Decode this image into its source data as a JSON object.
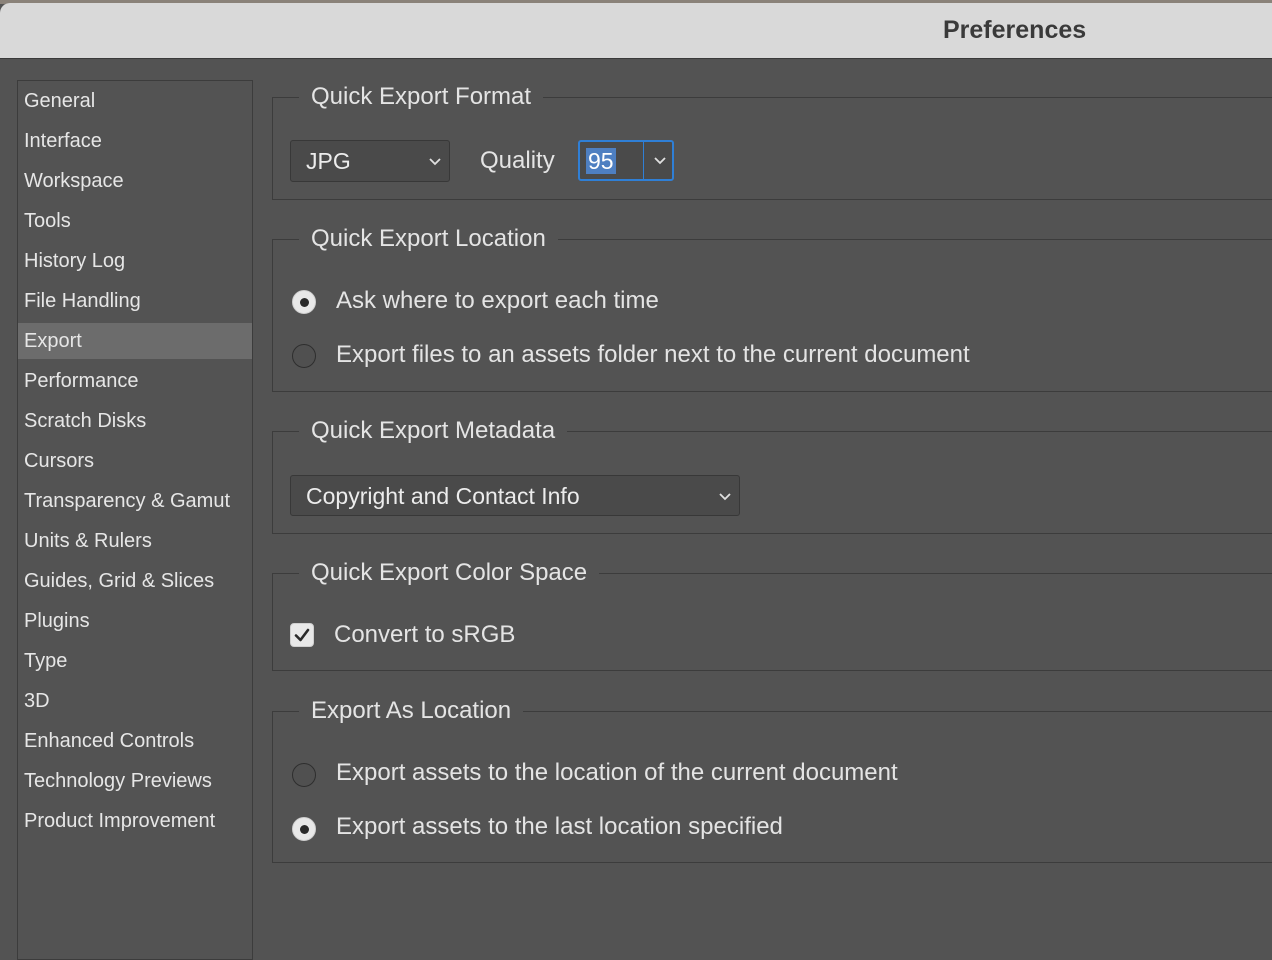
{
  "window": {
    "title": "Preferences"
  },
  "sidebar": {
    "selected": "Export",
    "items": [
      {
        "label": "General"
      },
      {
        "label": "Interface"
      },
      {
        "label": "Workspace"
      },
      {
        "label": "Tools"
      },
      {
        "label": "History Log"
      },
      {
        "label": "File Handling"
      },
      {
        "label": "Export"
      },
      {
        "label": "Performance"
      },
      {
        "label": "Scratch Disks"
      },
      {
        "label": "Cursors"
      },
      {
        "label": "Transparency & Gamut"
      },
      {
        "label": "Units & Rulers"
      },
      {
        "label": "Guides, Grid & Slices"
      },
      {
        "label": "Plugins"
      },
      {
        "label": "Type"
      },
      {
        "label": "3D"
      },
      {
        "label": "Enhanced Controls"
      },
      {
        "label": "Technology Previews"
      },
      {
        "label": "Product Improvement"
      }
    ]
  },
  "quick_export_format": {
    "title": "Quick Export Format",
    "format_value": "JPG",
    "quality_label": "Quality",
    "quality_value": "95"
  },
  "quick_export_location": {
    "title": "Quick Export Location",
    "options": [
      {
        "label": "Ask where to export each time",
        "selected": true
      },
      {
        "label": "Export files to an assets folder next to the current document",
        "selected": false
      }
    ]
  },
  "quick_export_metadata": {
    "title": "Quick Export Metadata",
    "value": "Copyright and Contact Info"
  },
  "quick_export_color_space": {
    "title": "Quick Export Color Space",
    "checkbox_label": "Convert to sRGB",
    "checked": true
  },
  "export_as_location": {
    "title": "Export As Location",
    "options": [
      {
        "label": "Export assets to the location of the current document",
        "selected": false
      },
      {
        "label": "Export assets to the last location specified",
        "selected": true
      }
    ]
  },
  "colors": {
    "background": "#535353",
    "titlebar": "#d9d9d9",
    "selection": "#6c6c6c",
    "focus_accent": "#2f7fd6"
  }
}
